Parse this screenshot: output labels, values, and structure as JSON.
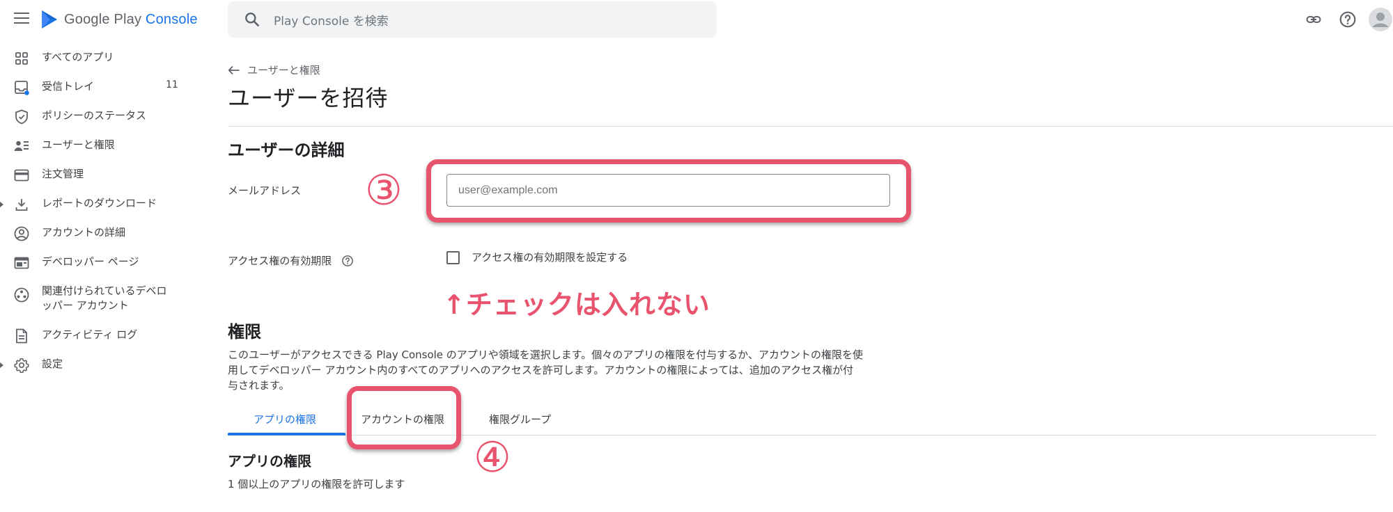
{
  "header": {
    "logo": {
      "brand": "Google Play",
      "product": "Console"
    },
    "search": {
      "placeholder": "Play Console を検索"
    },
    "icons": [
      "link-icon",
      "help-icon",
      "account-avatar"
    ]
  },
  "sidebar": {
    "items": [
      {
        "label": "すべてのアプリ",
        "icon": "apps-grid-icon"
      },
      {
        "label": "受信トレイ",
        "icon": "inbox-icon",
        "badge": "11"
      },
      {
        "label": "ポリシーのステータス",
        "icon": "shield-check-icon"
      },
      {
        "label": "ユーザーと権限",
        "icon": "users-list-icon"
      },
      {
        "label": "注文管理",
        "icon": "credit-card-icon"
      },
      {
        "label": "レポートのダウンロード",
        "icon": "download-icon",
        "expandable": true
      },
      {
        "label": "アカウントの詳細",
        "icon": "account-circle-icon"
      },
      {
        "label": "デベロッパー ページ",
        "icon": "web-page-icon"
      },
      {
        "label": "関連付けられているデベロ",
        "label2": "ッパー アカウント",
        "icon": "linked-accounts-icon"
      },
      {
        "label": "アクティビティ ログ",
        "icon": "document-icon"
      },
      {
        "label": "設定",
        "icon": "gear-icon",
        "expandable": true
      }
    ]
  },
  "main": {
    "breadcrumb": "ユーザーと権限",
    "page_title": "ユーザーを招待",
    "user_details": {
      "title": "ユーザーの詳細",
      "email_label": "メールアドレス",
      "email_placeholder": "user@example.com",
      "email_value": "",
      "access_expiry_label": "アクセス権の有効期限",
      "access_expiry_checkbox_label": "アクセス権の有効期限を設定する",
      "access_expiry_checked": false
    },
    "permissions": {
      "title": "権限",
      "description_lines": [
        "このユーザーがアクセスできる Play Console のアプリや領域を選択します。個々のアプリの権限を付与するか、アカウントの権限を使",
        "用してデベロッパー アカウント内のすべてのアプリへのアクセスを許可します。アカウントの権限によっては、追加のアクセス権が付",
        "与されます。"
      ],
      "tabs": [
        {
          "label": "アプリの権限",
          "active": true
        },
        {
          "label": "アカウントの権限",
          "active": false
        },
        {
          "label": "権限グループ",
          "active": false
        }
      ],
      "app_permissions_title": "アプリの権限",
      "app_permissions_desc": "1 個以上のアプリの権限を許可します"
    }
  },
  "annotations": {
    "step3": "③",
    "step4": "④",
    "note": "↑チェックは入れない",
    "color": "#e8536d"
  },
  "colors": {
    "accent": "#1a73e8",
    "annotation": "#e8536d"
  }
}
